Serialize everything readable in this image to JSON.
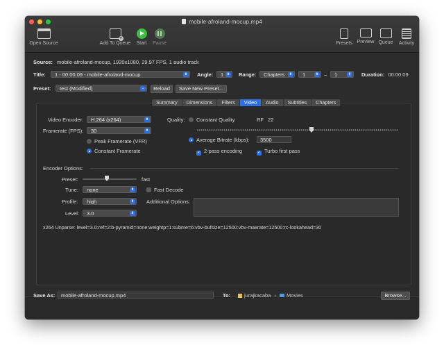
{
  "window": {
    "title": "mobile-afroland-mocup.mp4"
  },
  "toolbar": {
    "open_source": "Open Source",
    "add_to_queue": "Add To Queue",
    "start": "Start",
    "pause": "Pause",
    "presets": "Presets",
    "preview": "Preview",
    "queue": "Queue",
    "activity": "Activity"
  },
  "source": {
    "label": "Source:",
    "value": "mobile-afroland-mocup, 1920x1080, 29.97 FPS, 1 audio track"
  },
  "title_row": {
    "title_label": "Title:",
    "title_value": "1 - 00:00:09 - mobile-afroland-mocup",
    "angle_label": "Angle:",
    "angle_value": "1",
    "range_label": "Range:",
    "range_type": "Chapters",
    "range_start": "1",
    "range_dash": "–",
    "range_end": "1",
    "duration_label": "Duration:",
    "duration_value": "00:00:09"
  },
  "preset_row": {
    "label": "Preset:",
    "value": "test (Modified)",
    "reload": "Reload",
    "save_new": "Save New Preset..."
  },
  "tabs": [
    "Summary",
    "Dimensions",
    "Filters",
    "Video",
    "Audio",
    "Subtitles",
    "Chapters"
  ],
  "active_tab": "Video",
  "video": {
    "encoder_label": "Video Encoder:",
    "encoder_value": "H.264 (x264)",
    "framerate_label": "Framerate (FPS):",
    "framerate_value": "30",
    "peak_framerate": "Peak Framerate (VFR)",
    "constant_framerate": "Constant Framerate",
    "quality_label": "Quality:",
    "constant_quality": "Constant Quality",
    "rf_label": "RF",
    "rf_value": "22",
    "avg_bitrate": "Average Bitrate (kbps):",
    "avg_bitrate_value": "3500",
    "two_pass": "2-pass encoding",
    "turbo": "Turbo first pass"
  },
  "encoder_options": {
    "header": "Encoder Options:",
    "preset_label": "Preset:",
    "preset_value": "fast",
    "tune_label": "Tune:",
    "tune_value": "none",
    "fast_decode": "Fast Decode",
    "profile_label": "Profile:",
    "profile_value": "high",
    "additional_label": "Additional Options:",
    "level_label": "Level:",
    "level_value": "3.0",
    "unparse": "x264 Unparse: level=3.0:ref=2:b-pyramid=none:weightp=1:subme=6:vbv-bufsize=12500:vbv-maxrate=12500:rc-lookahead=30"
  },
  "footer": {
    "save_as_label": "Save As:",
    "save_as_value": "mobile-afroland-mocup.mp4",
    "to_label": "To:",
    "path_user": "jurajkacaba",
    "path_sep": "›",
    "path_folder": "Movies",
    "browse": "Browse..."
  },
  "colors": {
    "accent": "#2f6fe0",
    "start_green": "#3fbf3f",
    "pause_green": "#4f7a4f",
    "window_bg": "#2c2c2c"
  }
}
